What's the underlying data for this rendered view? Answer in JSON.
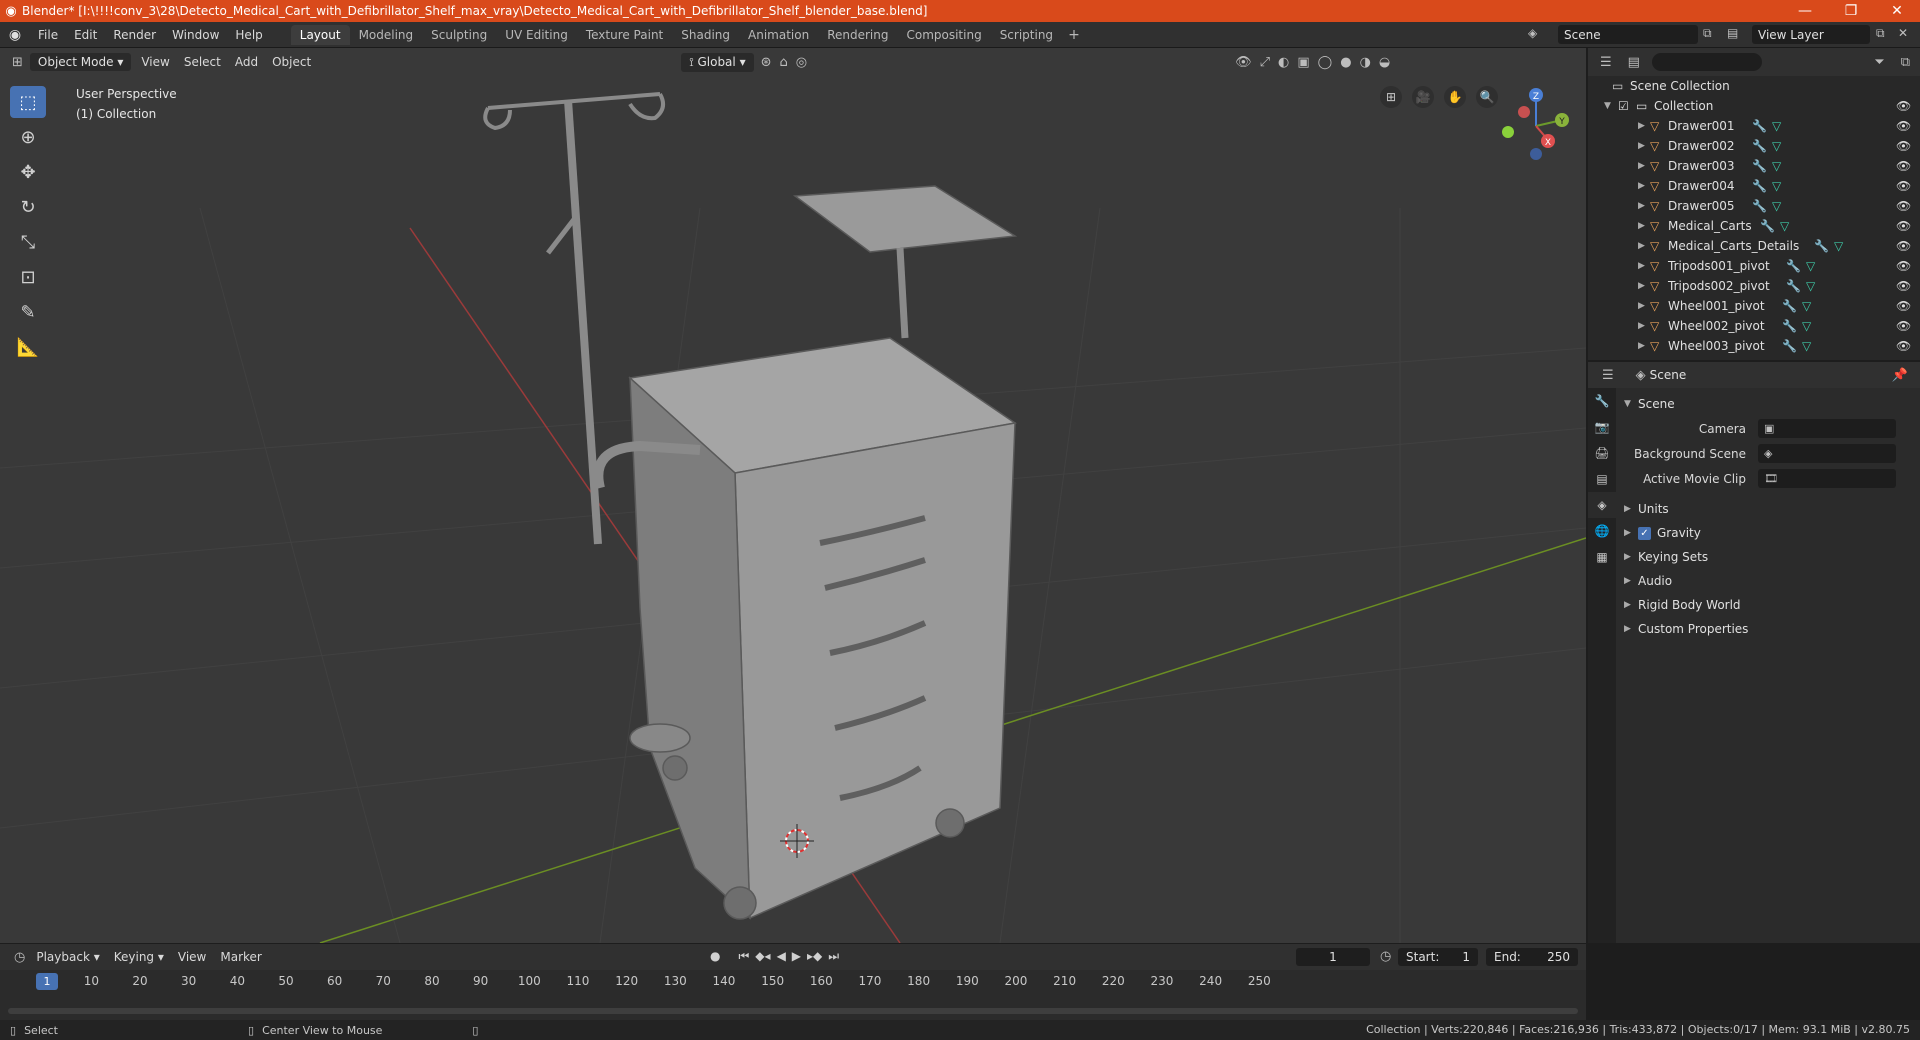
{
  "window": {
    "title": "Blender* [I:\\!!!!conv_3\\28\\Detecto_Medical_Cart_with_Defibrillator_Shelf_max_vray\\Detecto_Medical_Cart_with_Defibrillator_Shelf_blender_base.blend]",
    "minimize": "—",
    "maximize": "❐",
    "close": "✕"
  },
  "menu": [
    "File",
    "Edit",
    "Render",
    "Window",
    "Help"
  ],
  "workspaces": [
    "Layout",
    "Modeling",
    "Sculpting",
    "UV Editing",
    "Texture Paint",
    "Shading",
    "Animation",
    "Rendering",
    "Compositing",
    "Scripting"
  ],
  "active_workspace": "Layout",
  "scene_name": "Scene",
  "view_layer": "View Layer",
  "viewport": {
    "mode": "Object Mode",
    "menus": [
      "View",
      "Select",
      "Add",
      "Object"
    ],
    "transform_orientation": "Global",
    "info_line1": "User Perspective",
    "info_line2": "(1) Collection",
    "gizmo_axes": {
      "z": "Z",
      "y": "Y",
      "x": "X"
    }
  },
  "outliner": {
    "search_placeholder": "",
    "root": "Scene Collection",
    "collection": "Collection",
    "objects": [
      "Drawer001",
      "Drawer002",
      "Drawer003",
      "Drawer004",
      "Drawer005",
      "Medical_Carts",
      "Medical_Carts_Details",
      "Tripods001_pivot",
      "Tripods002_pivot",
      "Wheel001_pivot",
      "Wheel002_pivot",
      "Wheel003_pivot"
    ]
  },
  "properties": {
    "header": "Scene",
    "panel_title": "Scene",
    "camera_label": "Camera",
    "background_scene_label": "Background Scene",
    "active_clip_label": "Active Movie Clip",
    "sections": [
      "Units",
      "Gravity",
      "Keying Sets",
      "Audio",
      "Rigid Body World",
      "Custom Properties"
    ],
    "gravity_checked": true
  },
  "timeline": {
    "menus": [
      "Playback",
      "Keying",
      "View",
      "Marker"
    ],
    "current_frame": "1",
    "start_label": "Start:",
    "start": "1",
    "end_label": "End:",
    "end": "250",
    "ticks": [
      "10",
      "20",
      "30",
      "40",
      "50",
      "60",
      "70",
      "80",
      "90",
      "100",
      "110",
      "120",
      "130",
      "140",
      "150",
      "160",
      "170",
      "180",
      "190",
      "200",
      "210",
      "220",
      "230",
      "240",
      "250"
    ]
  },
  "status": {
    "left1": "Select",
    "left2": "Center View to Mouse",
    "right": "Collection | Verts:220,846 | Faces:216,936 | Tris:433,872 | Objects:0/17 | Mem: 93.1 MiB | v2.80.75"
  }
}
